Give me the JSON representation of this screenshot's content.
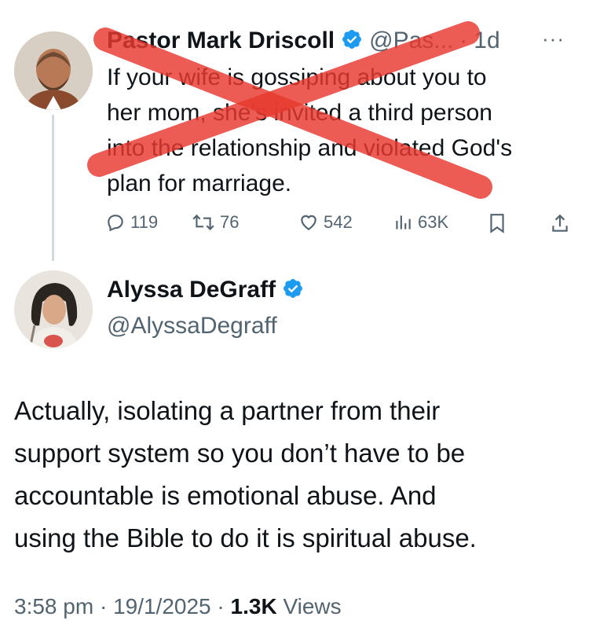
{
  "reply_to": {
    "author_name": "Pastor Mark Driscoll",
    "handle": "@Pas...",
    "separator": "·",
    "age": "1d",
    "more": "···",
    "text_lines": [
      "If your wife is gossiping about you to",
      "her mom, she's invited a third person",
      "into the relationship and violated God's",
      "plan for marriage."
    ],
    "stats": {
      "replies": "119",
      "reposts": "76",
      "likes": "542",
      "views": "63K"
    },
    "crossout_color": "#e8392f"
  },
  "tweet": {
    "author_name": "Alyssa DeGraff",
    "handle": "@AlyssaDegraff",
    "text_lines": [
      "Actually, isolating a partner from their",
      "support system so you don’t have to be",
      "accountable is emotional abuse. And",
      "using the Bible to do it is spiritual abuse."
    ],
    "time": "3:58 pm",
    "dot": "·",
    "date": "19/1/2025",
    "views_count": "1.3K",
    "views_label": "Views"
  },
  "colors": {
    "verified": "#1d9bf0",
    "muted": "#536471",
    "text": "#0f1419"
  }
}
